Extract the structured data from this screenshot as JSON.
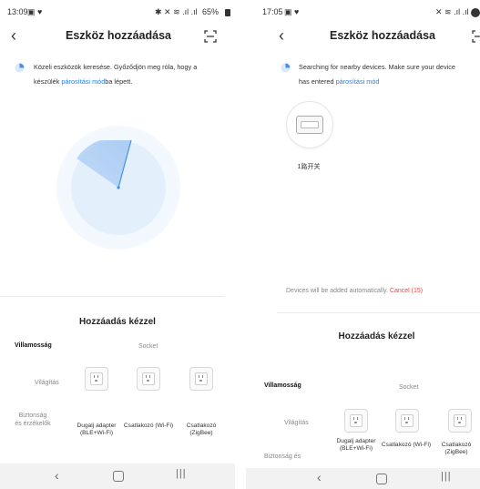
{
  "left": {
    "status": {
      "time": "13:09",
      "right": "65%"
    },
    "title": "Eszköz hozzáadása",
    "info_line1": "Közeli eszközök keresése. Győződjön meg róla, hogy a",
    "info_line2_pre": "készülék ",
    "info_link": "párosítási mód",
    "info_line2_post": "ba lépett.",
    "manual_title": "Hozzáadás kézzel",
    "categories": [
      "Villamosság",
      "Világítás",
      "Biztonság és érzékelők"
    ],
    "subcategory": "Socket",
    "devices": [
      {
        "label": "Dugalj adapter (BLE+Wi-Fi)"
      },
      {
        "label": "Csatlakozó (Wi-Fi)"
      },
      {
        "label": "Csatlakozó (ZigBee)"
      }
    ]
  },
  "right": {
    "status": {
      "time": "17:05"
    },
    "title": "Eszköz hozzáadása",
    "info_line1": "Searching for nearby devices. Make sure your device",
    "info_line2_pre": "has entered ",
    "info_link": "párosítási mód",
    "found_device_name": "1路开关",
    "auto_add_text": "Devices will be added automatically.",
    "cancel_text": "Cancel (15)",
    "manual_title": "Hozzáadás kézzel",
    "categories": [
      "Villamosság",
      "Világítás",
      "Biztonság és"
    ],
    "subcategory": "Socket",
    "devices": [
      {
        "label": "Dugalj adapter (BLE+Wi-Fi)"
      },
      {
        "label": "Csatlakozó (Wi-Fi)"
      },
      {
        "label": "Csatlakozó (ZigBee)"
      }
    ]
  },
  "icons": {
    "back": "back-arrow-icon",
    "scan": "scan-icon",
    "home": "home-icon",
    "recents": "recents-icon",
    "search": "searching-icon"
  },
  "colors": {
    "accent": "#2b7de1",
    "radar": "#4a90e2",
    "cancel": "#e24a4a"
  }
}
